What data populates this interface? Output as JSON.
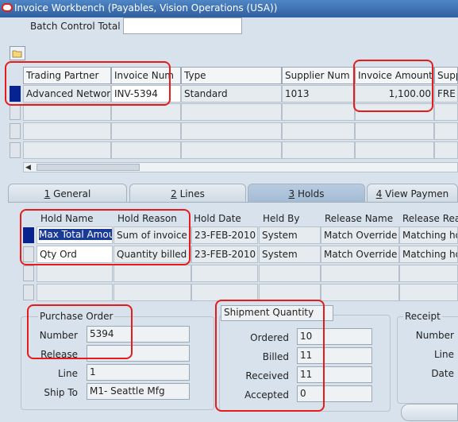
{
  "window": {
    "title": "Invoice Workbench (Payables, Vision Operations (USA))"
  },
  "batch": {
    "label": "Batch Control Total",
    "value": ""
  },
  "invoices": {
    "columns": [
      "Trading Partner",
      "Invoice Num",
      "Type",
      "Supplier Num",
      "Invoice Amount",
      "Supp"
    ],
    "rows": [
      [
        "Advanced Network",
        "INV-5394",
        "Standard",
        "1013",
        "1,100.00",
        "FRE"
      ]
    ]
  },
  "tabs": [
    {
      "num": "1",
      "label": " General"
    },
    {
      "num": "2",
      "label": " Lines"
    },
    {
      "num": "3",
      "label": " Holds"
    },
    {
      "num": "4",
      "label": " View Paymen"
    }
  ],
  "holds": {
    "columns": [
      "Hold Name",
      "Hold Reason",
      "Hold Date",
      "Held By",
      "Release Name",
      "Release Rea"
    ],
    "rows": [
      [
        "Max Total Amou",
        "Sum of invoice a",
        "23-FEB-2010",
        "System",
        "Match Override",
        "Matching ho"
      ],
      [
        "Qty Ord",
        "Quantity billed e",
        "23-FEB-2010",
        "System",
        "Match Override",
        "Matching ho"
      ]
    ]
  },
  "purchase_order": {
    "title": "Purchase Order",
    "number_label": "Number",
    "number": "5394",
    "release_label": "Release",
    "release": "",
    "line_label": "Line",
    "line": "1",
    "shipto_label": "Ship To",
    "shipto": "M1- Seattle Mfg"
  },
  "shipment": {
    "title": "Shipment Quantity",
    "ordered_label": "Ordered",
    "ordered": "10",
    "billed_label": "Billed",
    "billed": "11",
    "received_label": "Received",
    "received": "11",
    "accepted_label": "Accepted",
    "accepted": "0"
  },
  "receipt": {
    "title": "Receipt",
    "number_label": "Number",
    "line_label": "Line",
    "date_label": "Date"
  },
  "colors": {
    "highlight": "#e61c1c",
    "current_row": "#06238f",
    "title_bar": "#3a6db0"
  }
}
